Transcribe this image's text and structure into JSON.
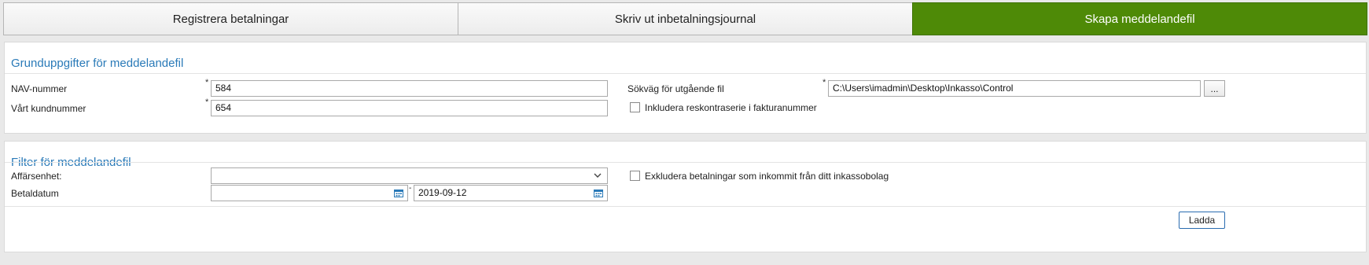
{
  "tabs": [
    {
      "label": "Registrera betalningar",
      "active": false
    },
    {
      "label": "Skriv ut inbetalningsjournal",
      "active": false
    },
    {
      "label": "Skapa meddelandefil",
      "active": true
    }
  ],
  "basic": {
    "title": "Grunduppgifter för meddelandefil",
    "nav_label": "NAV-nummer",
    "nav_value": "584",
    "customer_label": "Vårt kundnummer",
    "customer_value": "654",
    "path_label": "Sökväg för utgående fil",
    "path_value": "C:\\Users\\imadmin\\Desktop\\Inkasso\\Control",
    "browse_label": "...",
    "include_checkbox_label": "Inkludera reskontraserie i fakturanummer",
    "required_marker": "*"
  },
  "filter": {
    "title": "Filter för meddelandefil",
    "unit_label": "Affärsenhet:",
    "unit_value": "",
    "date_label": "Betaldatum",
    "date_from": "",
    "date_to": "2019-09-12",
    "range_separator": "-",
    "exclude_checkbox_label": "Exkludera betalningar som inkommit från ditt inkassobolag",
    "load_button": "Ladda"
  },
  "colors": {
    "active_tab": "#4e8a07",
    "section_title": "#2a7ab8"
  }
}
